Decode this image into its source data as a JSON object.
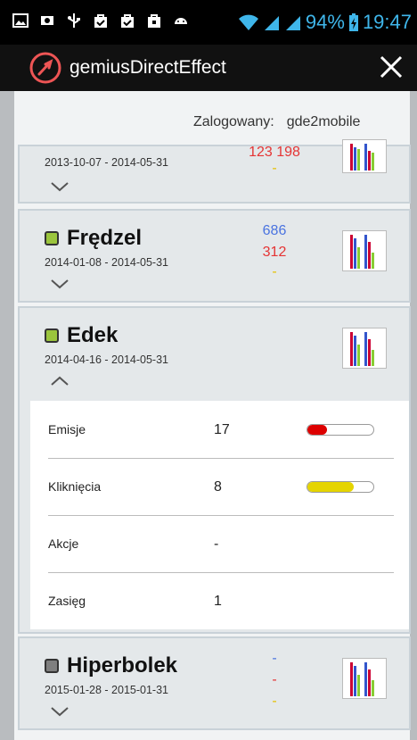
{
  "status_bar": {
    "battery": "94%",
    "time": "19:47",
    "left_icons": [
      "image-icon",
      "photo-icon",
      "usb-icon",
      "bag-check-icon",
      "bag-check-icon",
      "bag-icon",
      "android-icon"
    ]
  },
  "app": {
    "title": "gemiusDirectEffect"
  },
  "login": {
    "label": "Zalogowany:",
    "user": "gde2mobile"
  },
  "campaigns": [
    {
      "name": "",
      "dates": "2013-10-07 - 2014-05-31",
      "stat_red": "123 198",
      "stat_yellow": "-"
    },
    {
      "name": "Frędzel",
      "status_color": "#9bc53d",
      "dates": "2014-01-08 - 2014-05-31",
      "stat_blue": "686",
      "stat_red": "312",
      "stat_yellow": "-"
    },
    {
      "name": "Edek",
      "status_color": "#9bc53d",
      "dates": "2014-04-16 - 2014-05-31",
      "details": [
        {
          "label": "Emisje",
          "value": "17",
          "bar_fraction": 0.3,
          "bar_color": "#dd0000"
        },
        {
          "label": "Kliknięcia",
          "value": "8",
          "bar_fraction": 0.7,
          "bar_color": "#e5d400"
        },
        {
          "label": "Akcje",
          "value": "-"
        },
        {
          "label": "Zasięg",
          "value": "1"
        }
      ]
    },
    {
      "name": "Hiperbolek",
      "status_color": "#7f7f7f",
      "dates": "2015-01-28 - 2015-01-31",
      "stat_blue": "-",
      "stat_red": "-",
      "stat_yellow": "-"
    }
  ]
}
